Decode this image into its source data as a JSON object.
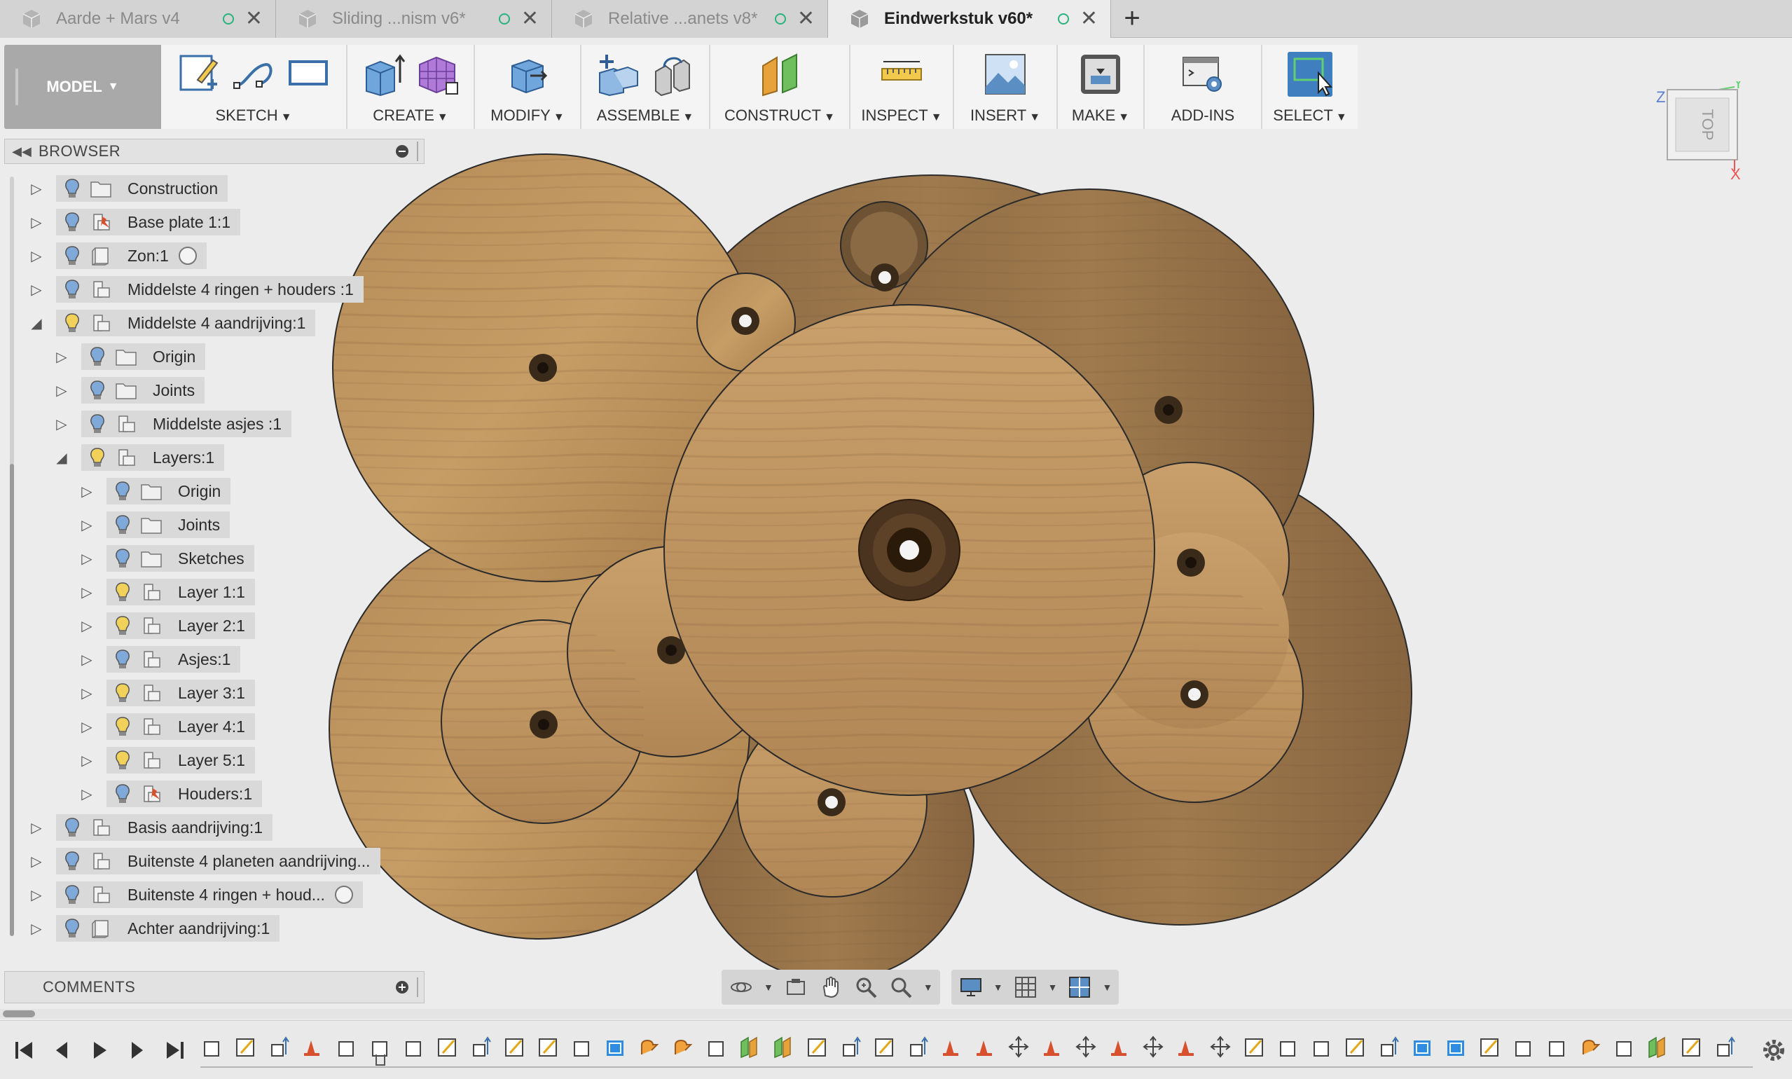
{
  "tabs": [
    {
      "label": "Aarde + Mars v4",
      "active": false
    },
    {
      "label": "Sliding ...nism v6*",
      "active": false
    },
    {
      "label": "Relative ...anets v8*",
      "active": false
    },
    {
      "label": "Eindwerkstuk v60*",
      "active": true
    }
  ],
  "new_tab_label": "+",
  "toolbar": {
    "workspace": "MODEL",
    "panels": [
      {
        "label": "SKETCH"
      },
      {
        "label": "CREATE"
      },
      {
        "label": "MODIFY"
      },
      {
        "label": "ASSEMBLE"
      },
      {
        "label": "CONSTRUCT"
      },
      {
        "label": "INSPECT"
      },
      {
        "label": "INSERT"
      },
      {
        "label": "MAKE"
      },
      {
        "label": "ADD-INS"
      },
      {
        "label": "SELECT"
      }
    ]
  },
  "viewcube": {
    "face": "TOP",
    "axis_z": "Z",
    "axis_y": "Y",
    "axis_x": "X"
  },
  "browser": {
    "title": "BROWSER",
    "nodes": [
      {
        "label": "Construction",
        "depth": 0,
        "expanded": false,
        "icon": "folder-icon",
        "bulb_on": false
      },
      {
        "label": "Base plate 1:1",
        "depth": 0,
        "expanded": false,
        "icon": "component-pinned-icon",
        "bulb_on": false
      },
      {
        "label": "Zon:1",
        "depth": 0,
        "expanded": false,
        "icon": "body-icon",
        "bulb_on": false,
        "radio": true
      },
      {
        "label": "Middelste 4 ringen + houders :1",
        "depth": 0,
        "expanded": false,
        "icon": "component-icon",
        "bulb_on": false
      },
      {
        "label": "Middelste 4 aandrijving:1",
        "depth": 0,
        "expanded": true,
        "icon": "component-icon",
        "bulb_on": true
      },
      {
        "label": "Origin",
        "depth": 1,
        "expanded": false,
        "icon": "folder-icon",
        "bulb_on": false
      },
      {
        "label": "Joints",
        "depth": 1,
        "expanded": false,
        "icon": "folder-icon",
        "bulb_on": false
      },
      {
        "label": "Middelste asjes :1",
        "depth": 1,
        "expanded": false,
        "icon": "component-icon",
        "bulb_on": false
      },
      {
        "label": "Layers:1",
        "depth": 1,
        "expanded": true,
        "icon": "component-icon",
        "bulb_on": true
      },
      {
        "label": "Origin",
        "depth": 2,
        "expanded": false,
        "icon": "folder-icon",
        "bulb_on": false
      },
      {
        "label": "Joints",
        "depth": 2,
        "expanded": false,
        "icon": "folder-icon",
        "bulb_on": false
      },
      {
        "label": "Sketches",
        "depth": 2,
        "expanded": false,
        "icon": "folder-icon",
        "bulb_on": false
      },
      {
        "label": "Layer 1:1",
        "depth": 2,
        "expanded": false,
        "icon": "component-icon",
        "bulb_on": true
      },
      {
        "label": "Layer 2:1",
        "depth": 2,
        "expanded": false,
        "icon": "component-icon",
        "bulb_on": true
      },
      {
        "label": "Asjes:1",
        "depth": 2,
        "expanded": false,
        "icon": "component-icon",
        "bulb_on": false
      },
      {
        "label": "Layer 3:1",
        "depth": 2,
        "expanded": false,
        "icon": "component-icon",
        "bulb_on": true
      },
      {
        "label": "Layer 4:1",
        "depth": 2,
        "expanded": false,
        "icon": "component-icon",
        "bulb_on": true
      },
      {
        "label": "Layer 5:1",
        "depth": 2,
        "expanded": false,
        "icon": "component-icon",
        "bulb_on": true
      },
      {
        "label": "Houders:1",
        "depth": 2,
        "expanded": false,
        "icon": "component-pinned-icon",
        "bulb_on": false
      },
      {
        "label": "Basis aandrijving:1",
        "depth": 0,
        "expanded": false,
        "icon": "component-icon",
        "bulb_on": false
      },
      {
        "label": "Buitenste 4 planeten aandrijving...",
        "depth": 0,
        "expanded": false,
        "icon": "component-icon",
        "bulb_on": false
      },
      {
        "label": "Buitenste 4 ringen + houd...",
        "depth": 0,
        "expanded": false,
        "icon": "component-icon",
        "bulb_on": false,
        "radio": true
      },
      {
        "label": "Achter aandrijving:1",
        "depth": 0,
        "expanded": false,
        "icon": "body-icon",
        "bulb_on": false
      }
    ]
  },
  "comments": {
    "title": "COMMENTS"
  },
  "colors": {
    "accent": "#3f7fbf",
    "wood_light": "#c49a62",
    "wood_dark": "#8a6a44",
    "bulb_on": "#f2d15a",
    "bulb_off": "#7fa9d8"
  },
  "timeline": {
    "feature_icons": [
      "body",
      "sketch",
      "extrude",
      "joint",
      "body",
      "body",
      "body",
      "sketch",
      "extrude",
      "sketch",
      "sketch",
      "body",
      "rigid-group",
      "revolve",
      "revolve",
      "body",
      "construct",
      "construct",
      "sketch",
      "extrude",
      "sketch",
      "extrude",
      "joint",
      "joint",
      "move",
      "joint",
      "move",
      "joint",
      "move",
      "joint",
      "move",
      "sketch",
      "body",
      "body",
      "sketch",
      "extrude",
      "rigid-group",
      "rigid-group",
      "sketch",
      "body",
      "body",
      "revolve",
      "body",
      "construct",
      "sketch",
      "extrude"
    ]
  }
}
